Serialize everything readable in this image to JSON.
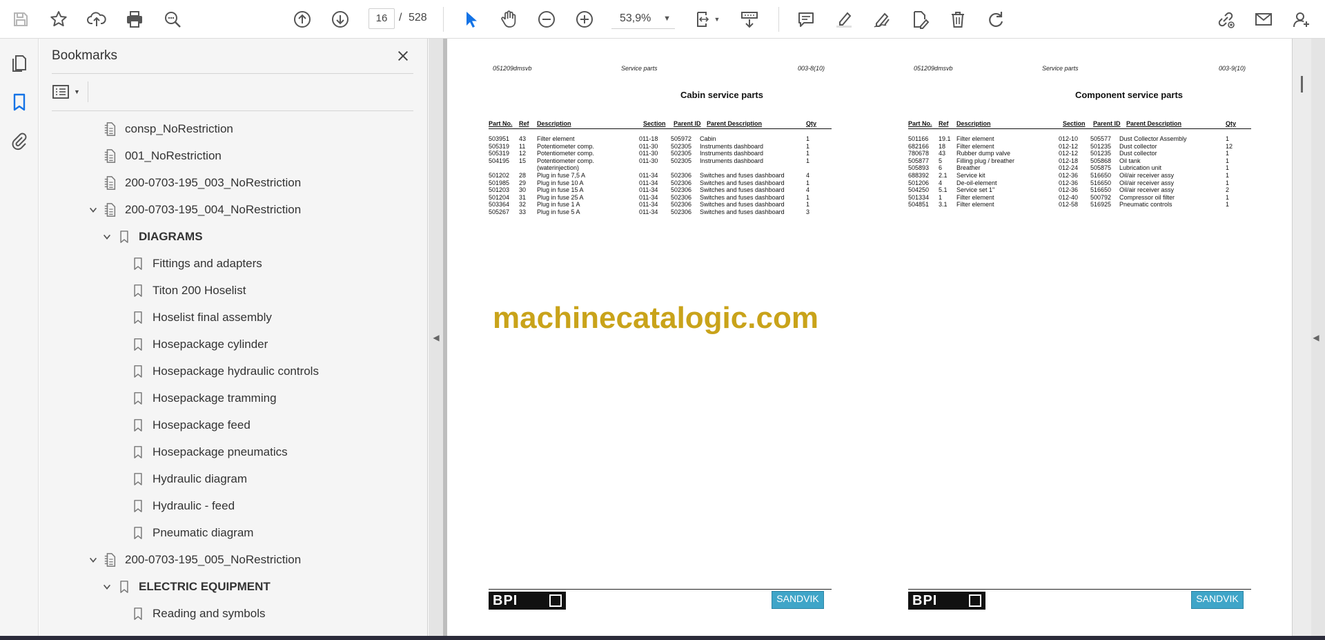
{
  "toolbar": {
    "page_current": "16",
    "page_separator": "/",
    "page_total": "528",
    "zoom": "53,9%",
    "icons": [
      "save-icon",
      "bookmark-star-icon",
      "upload-icon",
      "print-icon",
      "zoom-search-icon",
      "page-up-icon",
      "page-down-icon",
      "select-cursor-icon",
      "hand-icon",
      "zoom-out-icon",
      "zoom-in-icon",
      "zoom-dropdown-icon",
      "fit-page-icon",
      "scroll-mode-icon",
      "comment-icon",
      "highlight-icon",
      "sign-icon",
      "edit-pdf-icon",
      "delete-icon",
      "redo-icon",
      "share-link-icon",
      "email-icon",
      "account-icon"
    ]
  },
  "bookmarks": {
    "title": "Bookmarks",
    "items": [
      {
        "label": "consp_NoRestriction",
        "level": 0,
        "icon": "tagged-bookmark-icon",
        "expanded": null,
        "bold": false
      },
      {
        "label": "001_NoRestriction",
        "level": 0,
        "icon": "tagged-bookmark-icon",
        "expanded": null,
        "bold": false
      },
      {
        "label": "200-0703-195_003_NoRestriction",
        "level": 0,
        "icon": "tagged-bookmark-icon",
        "expanded": null,
        "bold": false
      },
      {
        "label": "200-0703-195_004_NoRestriction",
        "level": 0,
        "icon": "tagged-bookmark-icon",
        "expanded": true,
        "bold": false
      },
      {
        "label": "DIAGRAMS",
        "level": 1,
        "icon": "bookmark-icon",
        "expanded": true,
        "bold": true
      },
      {
        "label": "Fittings and adapters",
        "level": 2,
        "icon": "bookmark-icon",
        "expanded": null,
        "bold": false
      },
      {
        "label": "Titon 200 Hoselist",
        "level": 2,
        "icon": "bookmark-icon",
        "expanded": null,
        "bold": false
      },
      {
        "label": "Hoselist final assembly",
        "level": 2,
        "icon": "bookmark-icon",
        "expanded": null,
        "bold": false
      },
      {
        "label": "Hosepackage cylinder",
        "level": 2,
        "icon": "bookmark-icon",
        "expanded": null,
        "bold": false
      },
      {
        "label": "Hosepackage hydraulic controls",
        "level": 2,
        "icon": "bookmark-icon",
        "expanded": null,
        "bold": false
      },
      {
        "label": "Hosepackage tramming",
        "level": 2,
        "icon": "bookmark-icon",
        "expanded": null,
        "bold": false
      },
      {
        "label": "Hosepackage feed",
        "level": 2,
        "icon": "bookmark-icon",
        "expanded": null,
        "bold": false
      },
      {
        "label": "Hosepackage pneumatics",
        "level": 2,
        "icon": "bookmark-icon",
        "expanded": null,
        "bold": false
      },
      {
        "label": "Hydraulic diagram",
        "level": 2,
        "icon": "bookmark-icon",
        "expanded": null,
        "bold": false
      },
      {
        "label": "Hydraulic - feed",
        "level": 2,
        "icon": "bookmark-icon",
        "expanded": null,
        "bold": false
      },
      {
        "label": "Pneumatic diagram",
        "level": 2,
        "icon": "bookmark-icon",
        "expanded": null,
        "bold": false
      },
      {
        "label": "200-0703-195_005_NoRestriction",
        "level": 0,
        "icon": "tagged-bookmark-icon",
        "expanded": true,
        "bold": false
      },
      {
        "label": "ELECTRIC EQUIPMENT",
        "level": 1,
        "icon": "bookmark-icon",
        "expanded": true,
        "bold": true
      },
      {
        "label": "Reading and symbols",
        "level": 2,
        "icon": "bookmark-icon",
        "expanded": null,
        "bold": false
      }
    ]
  },
  "document": {
    "watermark": "machinecatalogic.com",
    "pages": [
      {
        "doc_id": "051209dmsvb",
        "header_center": "Service parts",
        "page_ref": "003-8(10)",
        "title": "Cabin service parts",
        "columns": [
          "Part No.",
          "Ref",
          "Description",
          "Section",
          "Parent ID",
          "Parent Description",
          "Qty"
        ],
        "rows": [
          [
            "503951",
            "43",
            "Filter element",
            "011-18",
            "505972",
            "Cabin",
            "1"
          ],
          [
            "505319",
            "11",
            "Potentiometer comp.",
            "011-30",
            "502305",
            "Instruments dashboard",
            "1"
          ],
          [
            "505319",
            "12",
            "Potentiometer comp.",
            "011-30",
            "502305",
            "Instruments dashboard",
            "1"
          ],
          [
            "504195",
            "15",
            "Potentiometer comp. (waterinjection)",
            "011-30",
            "502305",
            "Instruments dashboard",
            "1"
          ],
          [
            "501202",
            "28",
            "Plug in fuse 7,5 A",
            "011-34",
            "502306",
            "Switches and fuses dashboard",
            "4"
          ],
          [
            "501985",
            "29",
            "Plug in fuse 10 A",
            "011-34",
            "502306",
            "Switches and fuses dashboard",
            "1"
          ],
          [
            "501203",
            "30",
            "Plug in fuse 15 A",
            "011-34",
            "502306",
            "Switches and fuses dashboard",
            "4"
          ],
          [
            "501204",
            "31",
            "Plug in fuse 25 A",
            "011-34",
            "502306",
            "Switches and fuses dashboard",
            "1"
          ],
          [
            "503364",
            "32",
            "Plug in fuse 1 A",
            "011-34",
            "502306",
            "Switches and fuses dashboard",
            "1"
          ],
          [
            "505267",
            "33",
            "Plug in fuse 5 A",
            "011-34",
            "502306",
            "Switches and fuses dashboard",
            "3"
          ]
        ],
        "logo_left": "BPI",
        "logo_right": "SANDVIK"
      },
      {
        "doc_id": "051209dmsvb",
        "header_center": "Service parts",
        "page_ref": "003-9(10)",
        "title": "Component service parts",
        "columns": [
          "Part No.",
          "Ref",
          "Description",
          "Section",
          "Parent ID",
          "Parent Description",
          "Qty"
        ],
        "rows": [
          [
            "501166",
            "19.1",
            "Filter element",
            "012-10",
            "505577",
            "Dust Collector Assembly",
            "1"
          ],
          [
            "682166",
            "18",
            "Filter element",
            "012-12",
            "501235",
            "Dust collector",
            "12"
          ],
          [
            "780678",
            "43",
            "Rubber dump valve",
            "012-12",
            "501235",
            "Dust collector",
            "1"
          ],
          [
            "505877",
            "5",
            "Filling plug / breather",
            "012-18",
            "505868",
            "Oil tank",
            "1"
          ],
          [
            "505893",
            "6",
            "Breather",
            "012-24",
            "505875",
            "Lubrication unit",
            "1"
          ],
          [
            "688392",
            "2.1",
            "Service kit",
            "012-36",
            "516650",
            "Oil/air receiver assy",
            "1"
          ],
          [
            "501206",
            "4",
            "De-oil-element",
            "012-36",
            "516650",
            "Oil/air receiver assy",
            "1"
          ],
          [
            "504250",
            "5.1",
            "Service set 1\"",
            "012-36",
            "516650",
            "Oil/air receiver assy",
            "2"
          ],
          [
            "501334",
            "1",
            "Filter element",
            "012-40",
            "500792",
            "Compressor oil filter",
            "1"
          ],
          [
            "504851",
            "3.1",
            "Filter element",
            "012-58",
            "516925",
            "Pneumatic controls",
            "1"
          ]
        ],
        "logo_left": "BPI",
        "logo_right": "SANDVIK"
      }
    ]
  }
}
